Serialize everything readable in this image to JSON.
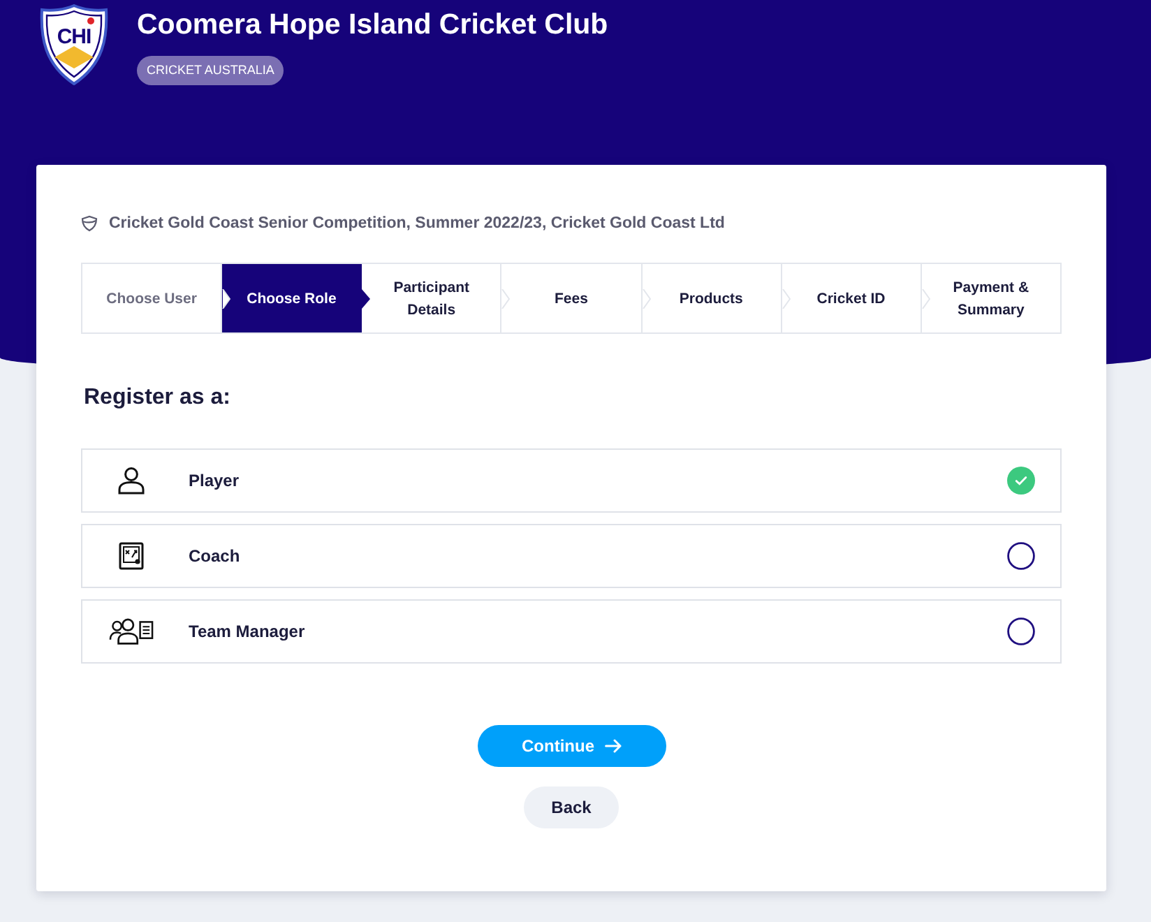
{
  "header": {
    "logo": {
      "monogram": "CHI"
    },
    "title": "Coomera Hope Island Cricket Club",
    "tag": "CRICKET AUSTRALIA"
  },
  "competition": "Cricket Gold Coast Senior Competition, Summer 2022/23, Cricket Gold Coast Ltd",
  "steps": [
    {
      "label": "Choose User",
      "selected": false
    },
    {
      "label": "Choose Role",
      "selected": true
    },
    {
      "label": "Participant Details",
      "selected": false
    },
    {
      "label": "Fees",
      "selected": false
    },
    {
      "label": "Products",
      "selected": false
    },
    {
      "label": "Cricket ID",
      "selected": false
    },
    {
      "label": "Payment & Summary",
      "selected": false
    }
  ],
  "heading": "Register as a:",
  "roles": [
    {
      "label": "Player",
      "selected": true
    },
    {
      "label": "Coach",
      "selected": false
    },
    {
      "label": "Team Manager",
      "selected": false
    }
  ],
  "buttons": [
    {
      "kind": "primary",
      "label": "Continue"
    },
    {
      "kind": "secondary",
      "label": "Back"
    }
  ]
}
